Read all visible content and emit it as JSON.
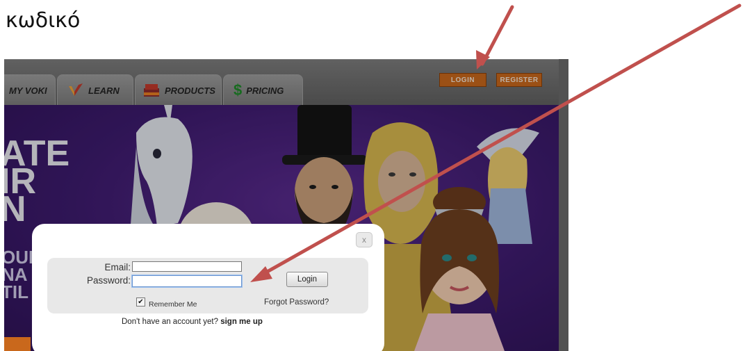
{
  "caption": "κωδικό",
  "nav": {
    "tabs": [
      {
        "label": "MY VOKI"
      },
      {
        "label": "LEARN"
      },
      {
        "label": "PRODUCTS"
      },
      {
        "label": "PRICING"
      }
    ],
    "login_label": "LOGIN",
    "register_label": "REGISTER"
  },
  "hero": {
    "lines": [
      "ATE",
      "IR",
      "N"
    ],
    "sub_lines": [
      "OUR",
      "NA",
      "TIL"
    ]
  },
  "login_dialog": {
    "close_label": "x",
    "email_label": "Email:",
    "email_value": "",
    "password_label": "Password:",
    "password_value": "",
    "login_button": "Login",
    "remember_label": "Remember Me",
    "remember_checked": true,
    "forgot_label": "Forgot Password?",
    "signup_prompt": "Don't have an account yet?",
    "signup_link": "sign me up"
  },
  "annotation_color": "#c0504d",
  "brand_orange": "#c7671b"
}
